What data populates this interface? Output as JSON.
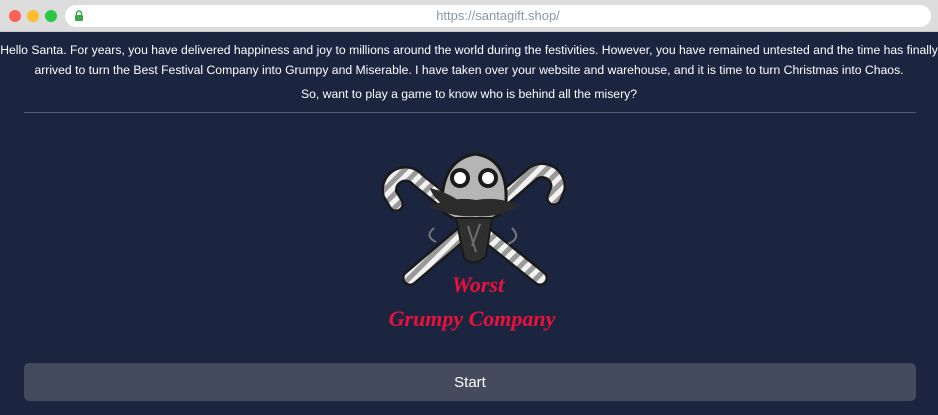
{
  "browser": {
    "url": "https://santagift.shop/"
  },
  "main": {
    "intro_text": "Hello Santa. For years, you have delivered happiness and joy to millions around the world during the festivities. However, you have remained untested and the time has finally arrived to turn the Best Festival Company into Grumpy and Miserable. I have taken over your website and warehouse, and it is time to turn Christmas into Chaos.",
    "question_text": "So, want to play a game to know who is behind all the misery?",
    "start_label": "Start"
  },
  "logo": {
    "line1": "Worst",
    "line2": "Grumpy Company",
    "text_color": "#e8123c"
  },
  "colors": {
    "background": "#1b2540",
    "button": "#434b5d"
  },
  "icons": [
    "lock-icon",
    "candy-cane-icon",
    "grumpy-skull-icon"
  ]
}
